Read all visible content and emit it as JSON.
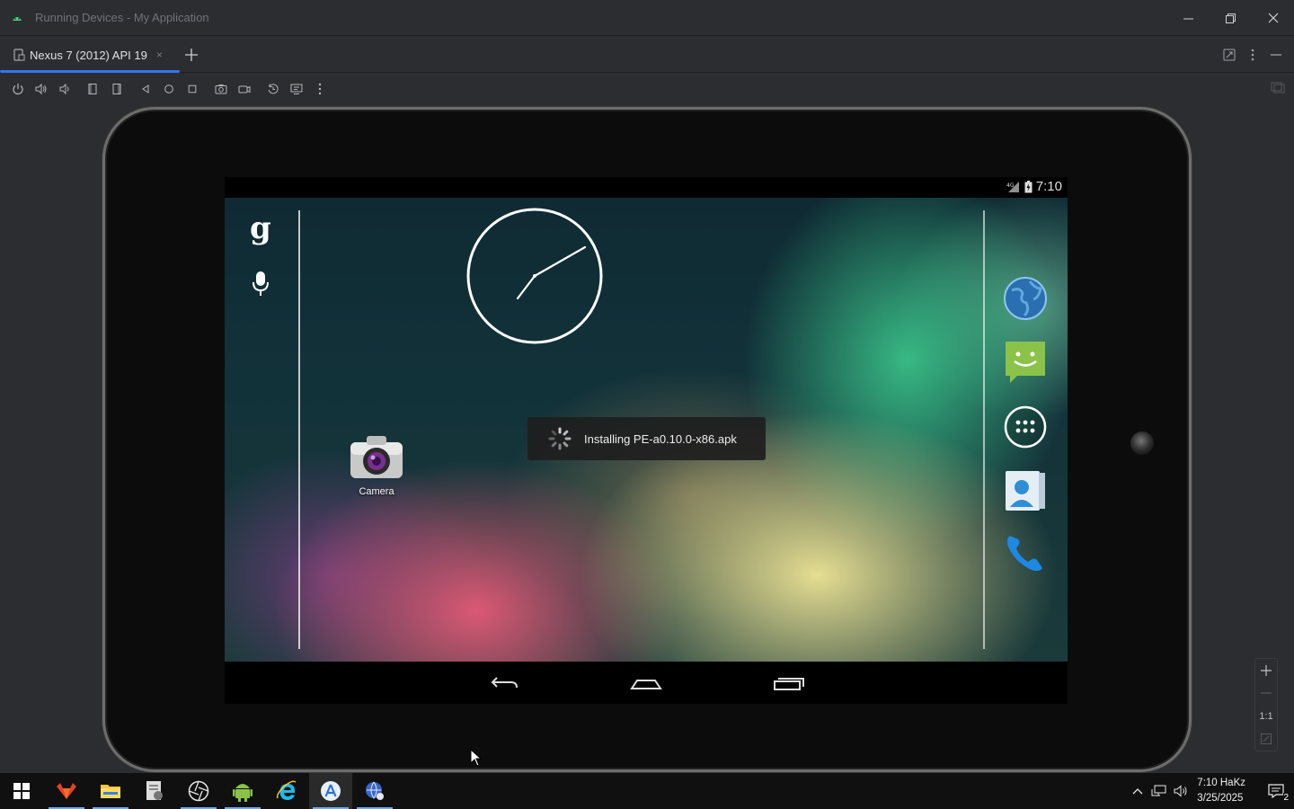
{
  "window": {
    "title": "Running Devices - My Application"
  },
  "tabs": [
    {
      "label": "Nexus 7 (2012) API 19",
      "close": "×"
    }
  ],
  "device": {
    "status_time": "7:10",
    "toast_text": "Installing PE-a0.10.0-x86.apk",
    "camera_label": "Camera",
    "google_letter": "g"
  },
  "zoom": {
    "plus": "+",
    "minus": "−",
    "one_to_one": "1:1"
  },
  "taskbar": {
    "time": "7:10 HaKz",
    "date": "3/25/2025",
    "notification_count": "2"
  },
  "colors": {
    "accent": "#3574f0",
    "ide_bg": "#2b2d30",
    "taskbar_bg": "#101010"
  }
}
